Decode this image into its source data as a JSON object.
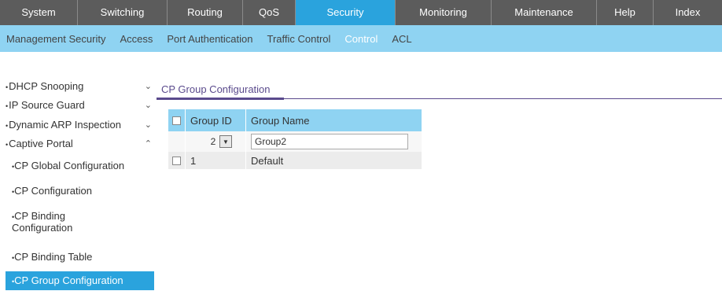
{
  "topnav": [
    {
      "label": "System",
      "active": false
    },
    {
      "label": "Switching",
      "active": false
    },
    {
      "label": "Routing",
      "active": false
    },
    {
      "label": "QoS",
      "active": false
    },
    {
      "label": "Security",
      "active": true
    },
    {
      "label": "Monitoring",
      "active": false
    },
    {
      "label": "Maintenance",
      "active": false
    },
    {
      "label": "Help",
      "active": false
    },
    {
      "label": "Index",
      "active": false
    }
  ],
  "subnav": [
    {
      "label": "Management Security",
      "active": false
    },
    {
      "label": "Access",
      "active": false
    },
    {
      "label": "Port Authentication",
      "active": false
    },
    {
      "label": "Traffic Control",
      "active": false
    },
    {
      "label": "Control",
      "active": true
    },
    {
      "label": "ACL",
      "active": false
    }
  ],
  "sidemenu": {
    "items": [
      {
        "label": "DHCP Snooping",
        "chevron": "⌄"
      },
      {
        "label": "IP Source Guard",
        "chevron": "⌄"
      },
      {
        "label": "Dynamic ARP Inspection",
        "chevron": "⌄"
      },
      {
        "label": "Captive Portal",
        "chevron": "⌃"
      }
    ],
    "subitems": [
      {
        "label": "CP Global Configuration",
        "selected": false
      },
      {
        "label": "CP Configuration",
        "selected": false
      },
      {
        "label": "CP Binding Configuration",
        "selected": false
      },
      {
        "label": "CP Binding Table",
        "selected": false
      },
      {
        "label": "CP Group Configuration",
        "selected": true
      }
    ]
  },
  "content": {
    "title": "CP Group Configuration",
    "table": {
      "headers": {
        "group_id": "Group ID",
        "group_name": "Group Name"
      },
      "edit_row": {
        "group_id": "2",
        "group_name": "Group2"
      },
      "rows": [
        {
          "group_id": "1",
          "group_name": "Default"
        }
      ]
    }
  }
}
